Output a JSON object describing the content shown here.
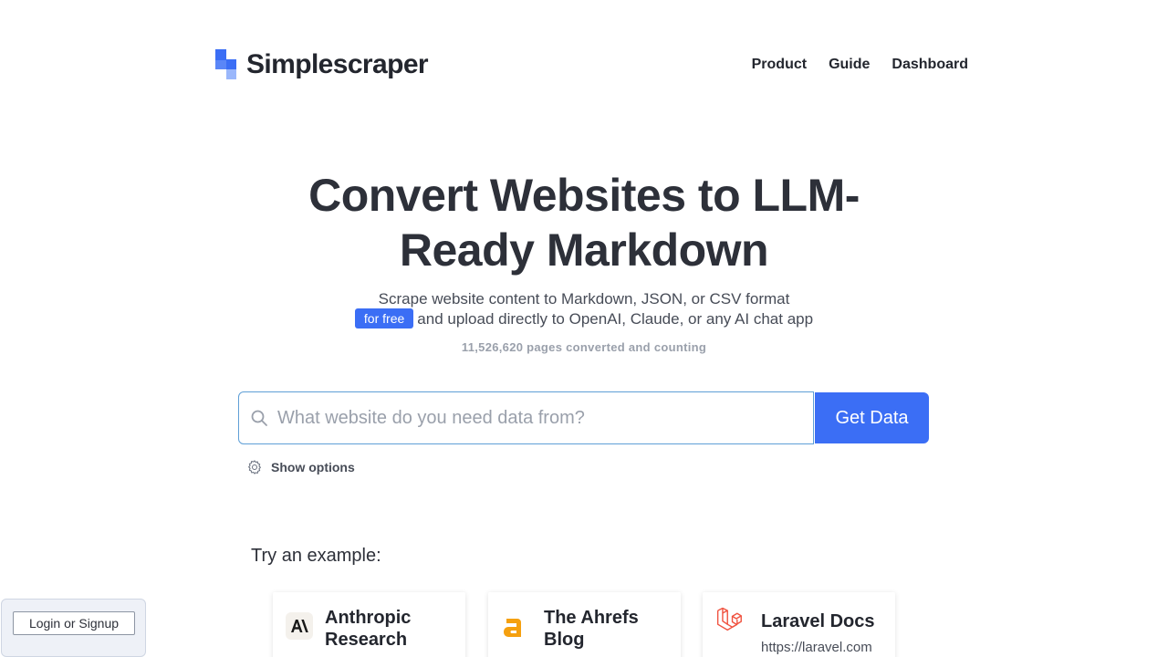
{
  "brand": {
    "name": "Simplescraper"
  },
  "nav": {
    "items": [
      "Product",
      "Guide",
      "Dashboard"
    ]
  },
  "hero": {
    "title": "Convert Websites to LLM-Ready Markdown",
    "subtitle_line1": "Scrape website content to Markdown, JSON, or CSV format",
    "badge": "for free",
    "subtitle_line2": "and upload directly to OpenAI, Claude, or any AI chat app",
    "counter": "11,526,620 pages converted and counting"
  },
  "search": {
    "placeholder": "What website do you need data from?",
    "value": "",
    "button_label": "Get Data",
    "options_label": "Show options"
  },
  "examples": {
    "label": "Try an example:",
    "cards": [
      {
        "title": "Anthropic Research",
        "url": "",
        "icon": "anthropic-icon"
      },
      {
        "title": "The Ahrefs Blog",
        "url": "",
        "icon": "ahrefs-icon"
      },
      {
        "title": "Laravel Docs",
        "url": "https://laravel.com",
        "icon": "laravel-icon"
      }
    ]
  },
  "login": {
    "label": "Login or Signup"
  },
  "colors": {
    "accent": "#3b6ef5",
    "ahrefs": "#f5a00f",
    "laravel": "#f05340",
    "text": "#2d3039"
  }
}
